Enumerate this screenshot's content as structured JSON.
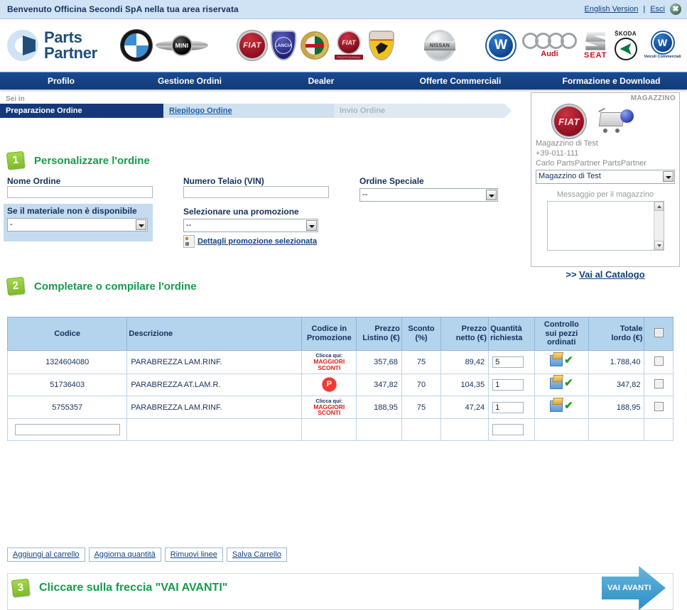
{
  "topbar": {
    "welcome": "Benvenuto Officina Secondi SpA nella tua area riservata",
    "english_link": "English Version",
    "separator": "|",
    "logout_link": "Esci",
    "close_icon": "✖"
  },
  "brand": {
    "line1": "Parts",
    "line2": "Partner",
    "logos": [
      {
        "name": "bmw-logo",
        "label": "BMW"
      },
      {
        "name": "mini-logo",
        "label": "MINI"
      },
      {
        "name": "fiat-logo",
        "label": "FIAT"
      },
      {
        "name": "lancia-logo",
        "label": "LANCIA"
      },
      {
        "name": "alfa-romeo-logo",
        "label": "ALFA ROMEO"
      },
      {
        "name": "fiat-professional-logo",
        "label": "FIAT PROFESSIONAL"
      },
      {
        "name": "abarth-logo",
        "label": "ABARTH"
      },
      {
        "name": "nissan-logo",
        "label": "NISSAN"
      },
      {
        "name": "volkswagen-logo",
        "label": "VW"
      },
      {
        "name": "audi-logo",
        "label": "Audi"
      },
      {
        "name": "seat-logo",
        "label": "SEAT"
      },
      {
        "name": "skoda-logo",
        "label": "ŠKODA"
      },
      {
        "name": "vw-veicoli-commerciali-logo",
        "label": "Veicoli Commerciali"
      }
    ]
  },
  "nav": {
    "items": [
      {
        "label": "Profilo"
      },
      {
        "label": "Gestione Ordini"
      },
      {
        "label": "Dealer"
      },
      {
        "label": "Offerte Commerciali"
      },
      {
        "label": "Formazione e Download"
      }
    ]
  },
  "breadcrumb": {
    "prefix": "Sei in",
    "steps": [
      {
        "label": "Preparazione Ordine",
        "state": "active"
      },
      {
        "label": "Riepilogo Ordine",
        "state": "link"
      },
      {
        "label": "Invio Ordine",
        "state": "disabled"
      }
    ]
  },
  "section1": {
    "number": "1",
    "title": "Personalizzare l'ordine",
    "nome_ordine_label": "Nome Ordine",
    "nome_ordine_value": "",
    "vin_label": "Numero Telaio (VIN)",
    "vin_value": "",
    "ordine_speciale_label": "Ordine Speciale",
    "ordine_speciale_value": "--",
    "materiale_label": "Se il materiale non è disponibile",
    "materiale_value": "-",
    "promozione_label": "Selezionare una promozione",
    "promozione_value": "--",
    "dettagli_link": "Dettagli promozione selezionata"
  },
  "magazzino": {
    "panel_title": "MAGAZZINO",
    "brand_icon": "fiat-logo",
    "cart_icon": "shopping-cart-icon",
    "name": "Magazzino di Test",
    "phone": "+39-011-111",
    "contact": "Carlo PartsPartner PartsPartner",
    "select_value": "Magazzino di Test",
    "message_label": "Messaggio per il magazzino",
    "message_value": "",
    "catalogo_prefix": ">> ",
    "catalogo_link": "Vai al Catalogo"
  },
  "section2": {
    "number": "2",
    "title": "Completare o compilare l'ordine",
    "table": {
      "headers": [
        "Codice",
        "Descrizione",
        "Codice in Promozione",
        "Prezzo Listino (€)",
        "Sconto (%)",
        "Prezzo netto (€)",
        "Quantità richiesta",
        "Controllo sui pezzi ordinati",
        "Totale lordo (€)",
        ""
      ],
      "headers_multiline": [
        [
          "Codice"
        ],
        [
          "Descrizione"
        ],
        [
          "Codice in",
          "Promozione"
        ],
        [
          "Prezzo",
          "Listino (€)"
        ],
        [
          "Sconto",
          "(%)"
        ],
        [
          "Prezzo",
          "netto (€)"
        ],
        [
          "Quantità",
          "richiesta"
        ],
        [
          "Controllo",
          "sui pezzi",
          "ordinati"
        ],
        [
          "Totale",
          "lordo (€)"
        ]
      ],
      "promo_text": {
        "line1": "Clicca qui:",
        "line2": "MAGGIORI",
        "line3": "SCONTI"
      },
      "promo_badge_label": "P",
      "rows": [
        {
          "codice": "1324604080",
          "descrizione": "PARABREZZA LAM.RINF.",
          "promo_type": "text",
          "prezzo_listino": "357,68",
          "sconto": "75",
          "prezzo_netto": "89,42",
          "quantita": "5",
          "controllo": "ok",
          "totale_lordo": "1.788,40",
          "selected": false
        },
        {
          "codice": "51736403",
          "descrizione": "PARABREZZA AT.LAM.R.",
          "promo_type": "badge",
          "prezzo_listino": "347,82",
          "sconto": "70",
          "prezzo_netto": "104,35",
          "quantita": "1",
          "controllo": "ok",
          "totale_lordo": "347,82",
          "selected": false
        },
        {
          "codice": "5755357",
          "descrizione": "PARABREZZA LAM.RINF.",
          "promo_type": "text",
          "prezzo_listino": "188,95",
          "sconto": "75",
          "prezzo_netto": "47,24",
          "quantita": "1",
          "controllo": "ok",
          "totale_lordo": "188,95",
          "selected": false
        }
      ],
      "new_row": {
        "codice_value": "",
        "quantita_value": ""
      }
    },
    "buttons": [
      {
        "label": "Aggiungi al carrello",
        "name": "add-to-cart-button"
      },
      {
        "label": "Aggiorna quantità",
        "name": "update-quantity-button"
      },
      {
        "label": "Rimuovi linee",
        "name": "remove-lines-button"
      },
      {
        "label": "Salva Carrello",
        "name": "save-cart-button"
      }
    ]
  },
  "section3": {
    "number": "3",
    "title": "Cliccare sulla freccia \"VAI AVANTI\"",
    "forward_button_label": "VAI AVANTI"
  },
  "colors": {
    "topbar_bg": "#cfe3f5",
    "nav_bg": "#16387a",
    "accent_green": "#169b4b",
    "table_header_bg": "#b4d3ec",
    "link_blue": "#12407d",
    "promo_red": "#e41b17",
    "arrow_blue": "#2a8fc4"
  }
}
